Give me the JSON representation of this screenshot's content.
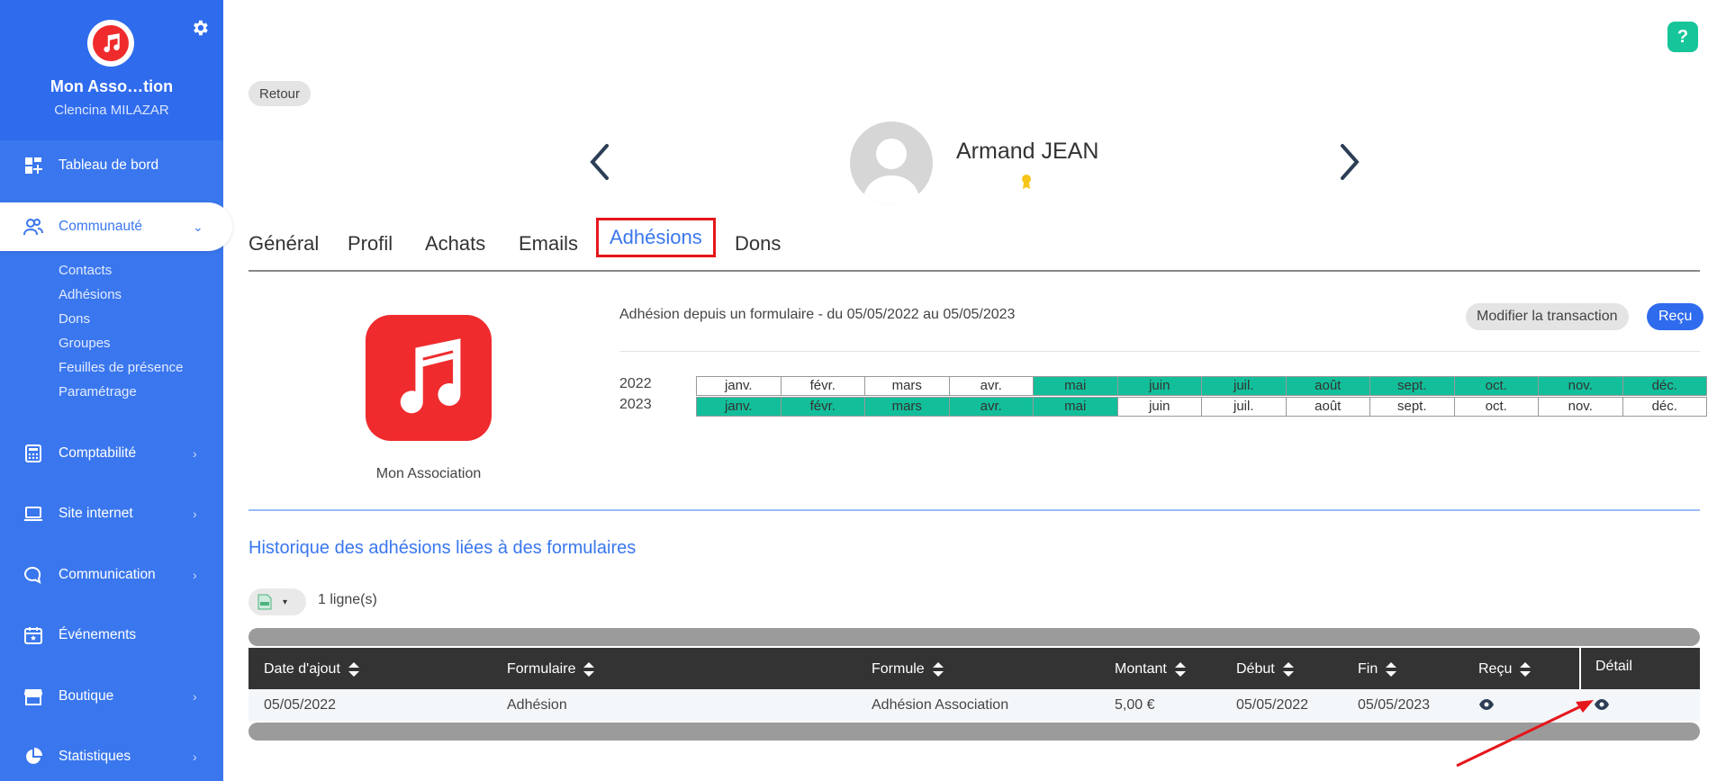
{
  "sidebar": {
    "org_name": "Mon Asso…tion",
    "user_name": "Clencina MILAZAR",
    "nav": [
      {
        "label": "Tableau de bord",
        "icon": "dashboard-icon"
      },
      {
        "label": "Communauté",
        "icon": "community-icon"
      },
      {
        "label": "Comptabilité",
        "icon": "calculator-icon"
      },
      {
        "label": "Site internet",
        "icon": "laptop-icon"
      },
      {
        "label": "Communication",
        "icon": "chat-icon"
      },
      {
        "label": "Événements",
        "icon": "calendar-icon"
      },
      {
        "label": "Boutique",
        "icon": "shop-icon"
      },
      {
        "label": "Statistiques",
        "icon": "pie-chart-icon"
      }
    ],
    "sub": [
      "Contacts",
      "Adhésions",
      "Dons",
      "Groupes",
      "Feuilles de présence",
      "Paramétrage"
    ]
  },
  "help_label": "?",
  "retour_label": "Retour",
  "person_name": "Armand JEAN",
  "tabs": [
    "Général",
    "Profil",
    "Achats",
    "Emails",
    "Adhésions",
    "Dons"
  ],
  "association_name": "Mon Association",
  "adhesion_desc": "Adhésion depuis un formulaire - du 05/05/2022 au 05/05/2023",
  "btn_modifier": "Modifier la transaction",
  "btn_recu": "Reçu",
  "months": [
    "janv.",
    "févr.",
    "mars",
    "avr.",
    "mai",
    "juin",
    "juil.",
    "août",
    "sept.",
    "oct.",
    "nov.",
    "déc."
  ],
  "calendar": [
    {
      "year": "2022",
      "active": [
        false,
        false,
        false,
        false,
        true,
        true,
        true,
        true,
        true,
        true,
        true,
        true
      ]
    },
    {
      "year": "2023",
      "active": [
        true,
        true,
        true,
        true,
        true,
        false,
        false,
        false,
        false,
        false,
        false,
        false
      ]
    }
  ],
  "accent_color": "#13bf9a",
  "history_title": "Historique des adhésions liées à des formulaires",
  "export_caret": "▾",
  "lines_count": "1 ligne(s)",
  "table": {
    "headers": [
      "Date d'ajout",
      "Formulaire",
      "Formule",
      "Montant",
      "Début",
      "Fin",
      "Reçu",
      "Détail"
    ],
    "row": {
      "date": "05/05/2022",
      "formulaire": "Adhésion",
      "formule": "Adhésion Association",
      "montant": "5,00 €",
      "debut": "05/05/2022",
      "fin": "05/05/2023"
    }
  }
}
